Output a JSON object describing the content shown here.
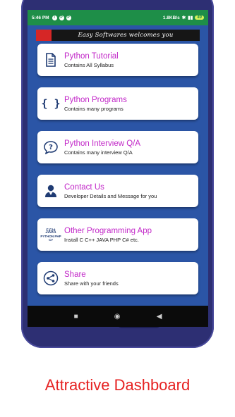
{
  "status_bar": {
    "time": "5:46 PM",
    "network_speed": "1.8KB/s",
    "battery": "49"
  },
  "banner": {
    "text": "Easy Softwares welcomes you"
  },
  "cards": [
    {
      "title": "Python Tutorial",
      "subtitle": "Contains All Syllabus",
      "icon": "document-icon"
    },
    {
      "title": "Python Programs",
      "subtitle": "Contains many programs",
      "icon": "braces-icon"
    },
    {
      "title": "Python Interview Q/A",
      "subtitle": "Contains many interview Q/A",
      "icon": "question-bubble-icon"
    },
    {
      "title": "Contact Us",
      "subtitle": "Developer Details and Message for you",
      "icon": "person-icon"
    },
    {
      "title": "Other Programming App",
      "subtitle": "Install C C++ JAVA PHP C# etc.",
      "icon": "languages-icon",
      "icon_text": [
        "C C++",
        "JAVA",
        "PYTHON PHP",
        "C#"
      ]
    },
    {
      "title": "Share",
      "subtitle": "Share with your friends",
      "icon": "share-icon"
    }
  ],
  "caption": "Attractive Dashboard",
  "colors": {
    "status_bar": "#1e8e48",
    "screen_background": "#2b55a6",
    "card_title": "#c228c8",
    "caption": "#e62222",
    "phone_frame": "#2d2f73"
  }
}
